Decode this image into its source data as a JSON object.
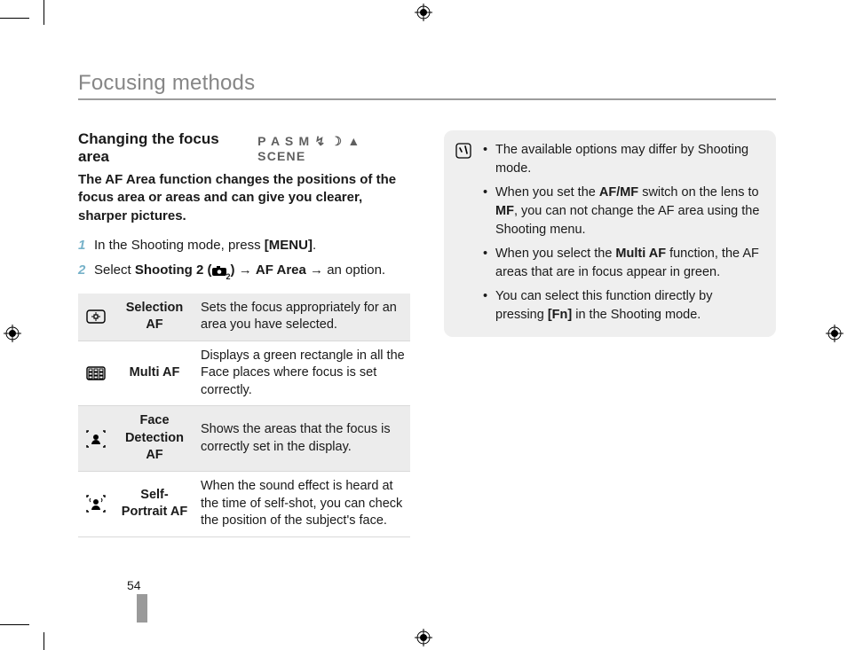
{
  "title": "Focusing methods",
  "section_heading": "Changing the focus area",
  "mode_icons_label": "P A S M ↯ ☽ ▲ SCENE",
  "intro": "The AF Area function changes the positions of the focus area or areas and can give you clearer, sharper pictures.",
  "steps": [
    {
      "num": "1",
      "pre": "In the Shooting mode, press ",
      "bold": "[MENU]",
      "post": "."
    },
    {
      "num": "2",
      "pre": "Select ",
      "bold": "Shooting 2 (",
      "mid_icon": true,
      "bold_suffix": ")",
      "arrow_target": "AF Area",
      "post_arrow": "an option."
    }
  ],
  "table": [
    {
      "name": "Selection AF",
      "desc": "Sets the focus appropriately for an area you have selected."
    },
    {
      "name": "Multi AF",
      "desc": "Displays a green rectangle in all the Face places where focus is set correctly."
    },
    {
      "name": "Face Detection AF",
      "desc": "Shows the areas that the focus is correctly set in the display."
    },
    {
      "name": "Self-Portrait AF",
      "desc": "When the sound effect is heard at the time of self-shot, you can check the position of the subject's face."
    }
  ],
  "notes": [
    "The available options may differ by Shooting mode.",
    {
      "parts": [
        "When you set the ",
        {
          "b": "AF/MF"
        },
        " switch on the lens to ",
        {
          "b": "MF"
        },
        ", you can not change the AF area using the Shooting menu."
      ]
    },
    {
      "parts": [
        "When you select the ",
        {
          "b": "Multi AF"
        },
        " function, the AF areas that are in focus appear in green."
      ]
    },
    {
      "parts": [
        "You can select this function directly by pressing ",
        {
          "b": "[Fn]"
        },
        " in the Shooting mode."
      ]
    }
  ],
  "page_number": "54"
}
